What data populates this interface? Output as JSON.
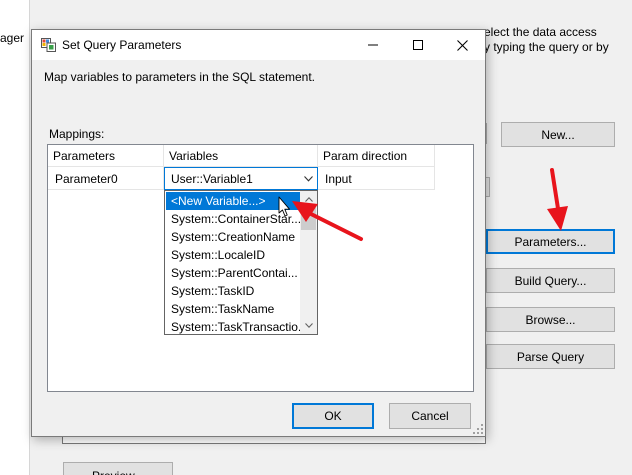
{
  "background": {
    "left_fragment": "ager",
    "description_line1": "elect the data access",
    "description_line2": "y typing the query or by",
    "new_button": "New...",
    "parameters_button": "Parameters...",
    "build_query_button": "Build Query...",
    "browse_button": "Browse...",
    "parse_query_button": "Parse Query",
    "preview_button": "Preview..."
  },
  "dialog": {
    "title": "Set Query Parameters",
    "description": "Map variables to parameters in the SQL statement.",
    "mappings_label": "Mappings:",
    "columns": [
      "Parameters",
      "Variables",
      "Param direction"
    ],
    "row": {
      "parameter": "Parameter0",
      "variable": "User::Variable1",
      "direction": "Input"
    },
    "dropdown_items": [
      "<New Variable...>",
      "System::ContainerStar...",
      "System::CreationName",
      "System::LocaleID",
      "System::ParentContai...",
      "System::TaskID",
      "System::TaskName",
      "System::TaskTransactio..."
    ],
    "selected_index": 0,
    "ok_button": "OK",
    "cancel_button": "Cancel"
  },
  "colors": {
    "accent": "#0078d7",
    "selection": "#0078d7",
    "annotation_arrow": "#e8141c"
  },
  "icons": [
    "app-icon",
    "minimize-icon",
    "maximize-icon",
    "close-icon",
    "chevron-down-icon",
    "scroll-up-icon",
    "scroll-down-icon",
    "mouse-cursor-icon",
    "resize-grip-icon"
  ]
}
